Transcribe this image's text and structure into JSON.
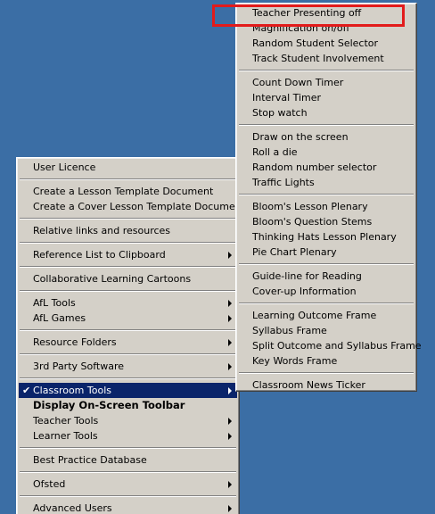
{
  "main_menu": {
    "items": [
      {
        "label": "User Licence"
      },
      {
        "label": "Create a Lesson Template Document"
      },
      {
        "label": "Create a Cover Lesson Template Document"
      },
      {
        "label": "Relative links and resources"
      },
      {
        "label": "Reference List to Clipboard"
      },
      {
        "label": "Collaborative Learning Cartoons"
      },
      {
        "label": "AfL Tools"
      },
      {
        "label": "AfL Games"
      },
      {
        "label": "Resource Folders"
      },
      {
        "label": "3rd Party Software"
      },
      {
        "label": "Classroom Tools",
        "checked": true,
        "selected": true
      },
      {
        "label": "Display On-Screen Toolbar"
      },
      {
        "label": "Teacher Tools"
      },
      {
        "label": "Learner Tools"
      },
      {
        "label": "Best Practice Database"
      },
      {
        "label": "Ofsted"
      },
      {
        "label": "Advanced Users"
      }
    ],
    "check_glyph": "✔"
  },
  "sub_menu": {
    "items": [
      {
        "label": "Teacher Presenting off"
      },
      {
        "label": "Magnification on/off"
      },
      {
        "label": "Random Student Selector"
      },
      {
        "label": "Track Student Involvement"
      },
      {
        "label": "Count Down Timer"
      },
      {
        "label": "Interval Timer"
      },
      {
        "label": "Stop watch"
      },
      {
        "label": "Draw on the screen"
      },
      {
        "label": "Roll a die"
      },
      {
        "label": "Random number selector"
      },
      {
        "label": "Traffic Lights"
      },
      {
        "label": "Bloom's Lesson Plenary"
      },
      {
        "label": "Bloom's Question Stems"
      },
      {
        "label": "Thinking Hats Lesson Plenary"
      },
      {
        "label": "Pie Chart Plenary"
      },
      {
        "label": "Guide-line for Reading"
      },
      {
        "label": "Cover-up Information"
      },
      {
        "label": "Learning Outcome Frame"
      },
      {
        "label": "Syllabus Frame"
      },
      {
        "label": "Split Outcome and Syllabus Frame"
      },
      {
        "label": "Key Words Frame"
      },
      {
        "label": "Classroom News Ticker"
      }
    ]
  },
  "colors": {
    "desktop": "#3b6ea5",
    "menu_bg": "#d4d0c8",
    "selected_bg": "#0a246a",
    "highlight_box": "#e21b1b"
  }
}
